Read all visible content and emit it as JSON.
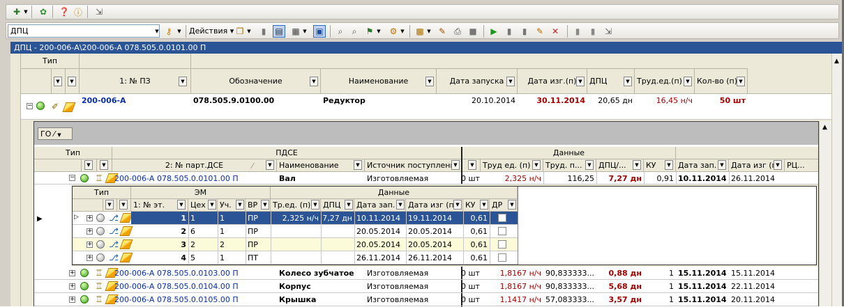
{
  "toolbar": {
    "search_value": "ДПЦ",
    "actions_label": "Действия"
  },
  "path": "ДПЦ - 200-006-А\\200-006-А 078.505.0.0101.00 П",
  "main": {
    "type_header": "Тип",
    "columns": [
      "1: № ПЗ",
      "Обозначение",
      "Наименование",
      "Дата запуска",
      "Дата изг.(п)",
      "ДПЦ",
      "Труд.ед.(п)",
      "Кол-во (п)"
    ],
    "row": {
      "pz": "200-006-А",
      "designation": "078.505.9.0100.00",
      "name": "Редуктор",
      "launch": "20.10.2014",
      "made": "30.11.2014",
      "dpc": "20,65 дн",
      "labor": "16,45 н/ч",
      "qty": "50 шт"
    }
  },
  "sub": {
    "group": "ГО",
    "type_header": "Тип",
    "pdse_header": "ПДСЕ",
    "data_header": "Данные",
    "columns": [
      "2: № парт.ДСЕ",
      "Наименование",
      "Источник поступления",
      "",
      "Труд ед. (п)",
      "Труд. п...",
      "ДПЦ/...",
      "КУ",
      "Дата зап.",
      "Дата изг (п)",
      "РЦ..."
    ],
    "rows": [
      {
        "part": "200-006-А 078.505.0.0101.00 П",
        "name": "Вал",
        "source": "Изготовляемая",
        "qty": "0 шт",
        "labor": "2,325 н/ч",
        "laborp": "116,25",
        "dpc": "7,27 дн",
        "ku": "0,91",
        "start": "10.11.2014",
        "made": "26.11.2014"
      },
      {
        "part": "200-006-А 078.505.0.0103.00 П",
        "name": "Колесо зубчатое",
        "source": "Изготовляемая",
        "qty": "0 шт",
        "labor": "1,8167 н/ч",
        "laborp": "90,833333...",
        "dpc": "0,88 дн",
        "ku": "1",
        "start": "15.11.2014",
        "made": "15.11.2014"
      },
      {
        "part": "200-006-А 078.505.0.0104.00 П",
        "name": "Корпус",
        "source": "Изготовляемая",
        "qty": "0 шт",
        "labor": "1,8167 н/ч",
        "laborp": "90,833333...",
        "dpc": "5,68 дн",
        "ku": "1",
        "start": "15.11.2014",
        "made": "22.11.2014"
      },
      {
        "part": "200-006-А 078.505.0.0105.00 П",
        "name": "Крышка",
        "source": "Изготовляемая",
        "qty": "0 шт",
        "labor": "1,1417 н/ч",
        "laborp": "57,083333...",
        "dpc": "3,57 дн",
        "ku": "1",
        "start": "15.11.2014",
        "made": "20.11.2014"
      }
    ]
  },
  "ops": {
    "type_header": "Тип",
    "em_header": "ЭМ",
    "data_header": "Данные",
    "columns": [
      "1: № эт.",
      "Цех",
      "Уч.",
      "ВР",
      "Тр.ед. (п)",
      "ДПЦ",
      "Дата зап.",
      "Дата изг (п)",
      "КУ",
      "ДР"
    ],
    "rows": [
      {
        "n": "1",
        "shop": "1",
        "area": "1",
        "vr": "ПР",
        "labor": "2,325 н/ч",
        "dpc": "7,27 дн",
        "start": "10.11.2014",
        "made": "19.11.2014",
        "ku": "0,61"
      },
      {
        "n": "2",
        "shop": "6",
        "area": "1",
        "vr": "ПР",
        "labor": "",
        "dpc": "",
        "start": "20.05.2014",
        "made": "20.05.2014",
        "ku": "0,61"
      },
      {
        "n": "3",
        "shop": "2",
        "area": "2",
        "vr": "ПР",
        "labor": "",
        "dpc": "",
        "start": "20.05.2014",
        "made": "20.05.2014",
        "ku": "0,61"
      },
      {
        "n": "4",
        "shop": "5",
        "area": "1",
        "vr": "ПТ",
        "labor": "",
        "dpc": "",
        "start": "26.11.2014",
        "made": "26.11.2014",
        "ku": "0,61"
      }
    ]
  }
}
